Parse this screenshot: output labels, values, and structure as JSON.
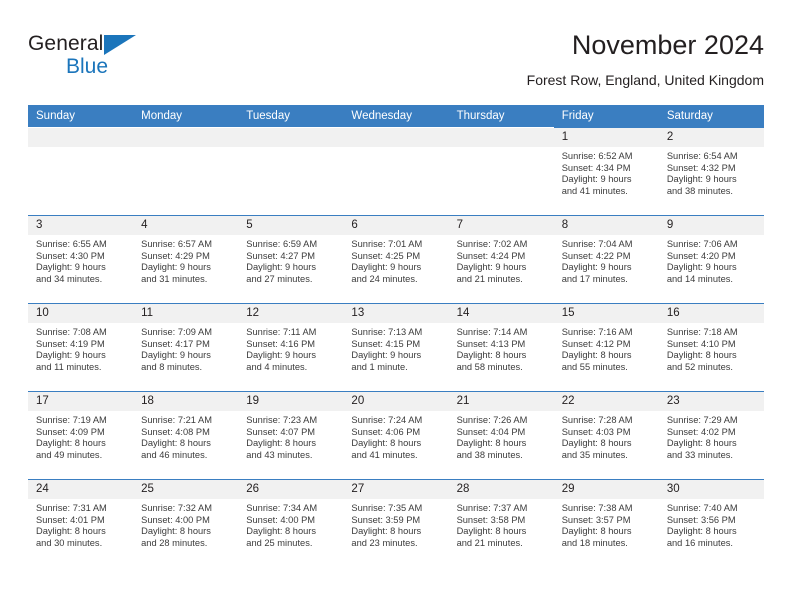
{
  "logo": {
    "word1": "General",
    "word2": "Blue",
    "triangle_color": "#1b75bb",
    "icon": "triangle-icon"
  },
  "header": {
    "month_title": "November 2024",
    "location": "Forest Row, England, United Kingdom"
  },
  "calendar": {
    "header_bg": "#3a7ec1",
    "daynum_bg": "#f1f1f1",
    "weekdays": [
      "Sunday",
      "Monday",
      "Tuesday",
      "Wednesday",
      "Thursday",
      "Friday",
      "Saturday"
    ],
    "weeks": [
      [
        {
          "empty": true
        },
        {
          "empty": true
        },
        {
          "empty": true
        },
        {
          "empty": true
        },
        {
          "empty": true
        },
        {
          "day": "1",
          "sunrise": "Sunrise: 6:52 AM",
          "sunset": "Sunset: 4:34 PM",
          "daylight1": "Daylight: 9 hours",
          "daylight2": "and 41 minutes."
        },
        {
          "day": "2",
          "sunrise": "Sunrise: 6:54 AM",
          "sunset": "Sunset: 4:32 PM",
          "daylight1": "Daylight: 9 hours",
          "daylight2": "and 38 minutes."
        }
      ],
      [
        {
          "day": "3",
          "sunrise": "Sunrise: 6:55 AM",
          "sunset": "Sunset: 4:30 PM",
          "daylight1": "Daylight: 9 hours",
          "daylight2": "and 34 minutes."
        },
        {
          "day": "4",
          "sunrise": "Sunrise: 6:57 AM",
          "sunset": "Sunset: 4:29 PM",
          "daylight1": "Daylight: 9 hours",
          "daylight2": "and 31 minutes."
        },
        {
          "day": "5",
          "sunrise": "Sunrise: 6:59 AM",
          "sunset": "Sunset: 4:27 PM",
          "daylight1": "Daylight: 9 hours",
          "daylight2": "and 27 minutes."
        },
        {
          "day": "6",
          "sunrise": "Sunrise: 7:01 AM",
          "sunset": "Sunset: 4:25 PM",
          "daylight1": "Daylight: 9 hours",
          "daylight2": "and 24 minutes."
        },
        {
          "day": "7",
          "sunrise": "Sunrise: 7:02 AM",
          "sunset": "Sunset: 4:24 PM",
          "daylight1": "Daylight: 9 hours",
          "daylight2": "and 21 minutes."
        },
        {
          "day": "8",
          "sunrise": "Sunrise: 7:04 AM",
          "sunset": "Sunset: 4:22 PM",
          "daylight1": "Daylight: 9 hours",
          "daylight2": "and 17 minutes."
        },
        {
          "day": "9",
          "sunrise": "Sunrise: 7:06 AM",
          "sunset": "Sunset: 4:20 PM",
          "daylight1": "Daylight: 9 hours",
          "daylight2": "and 14 minutes."
        }
      ],
      [
        {
          "day": "10",
          "sunrise": "Sunrise: 7:08 AM",
          "sunset": "Sunset: 4:19 PM",
          "daylight1": "Daylight: 9 hours",
          "daylight2": "and 11 minutes."
        },
        {
          "day": "11",
          "sunrise": "Sunrise: 7:09 AM",
          "sunset": "Sunset: 4:17 PM",
          "daylight1": "Daylight: 9 hours",
          "daylight2": "and 8 minutes."
        },
        {
          "day": "12",
          "sunrise": "Sunrise: 7:11 AM",
          "sunset": "Sunset: 4:16 PM",
          "daylight1": "Daylight: 9 hours",
          "daylight2": "and 4 minutes."
        },
        {
          "day": "13",
          "sunrise": "Sunrise: 7:13 AM",
          "sunset": "Sunset: 4:15 PM",
          "daylight1": "Daylight: 9 hours",
          "daylight2": "and 1 minute."
        },
        {
          "day": "14",
          "sunrise": "Sunrise: 7:14 AM",
          "sunset": "Sunset: 4:13 PM",
          "daylight1": "Daylight: 8 hours",
          "daylight2": "and 58 minutes."
        },
        {
          "day": "15",
          "sunrise": "Sunrise: 7:16 AM",
          "sunset": "Sunset: 4:12 PM",
          "daylight1": "Daylight: 8 hours",
          "daylight2": "and 55 minutes."
        },
        {
          "day": "16",
          "sunrise": "Sunrise: 7:18 AM",
          "sunset": "Sunset: 4:10 PM",
          "daylight1": "Daylight: 8 hours",
          "daylight2": "and 52 minutes."
        }
      ],
      [
        {
          "day": "17",
          "sunrise": "Sunrise: 7:19 AM",
          "sunset": "Sunset: 4:09 PM",
          "daylight1": "Daylight: 8 hours",
          "daylight2": "and 49 minutes."
        },
        {
          "day": "18",
          "sunrise": "Sunrise: 7:21 AM",
          "sunset": "Sunset: 4:08 PM",
          "daylight1": "Daylight: 8 hours",
          "daylight2": "and 46 minutes."
        },
        {
          "day": "19",
          "sunrise": "Sunrise: 7:23 AM",
          "sunset": "Sunset: 4:07 PM",
          "daylight1": "Daylight: 8 hours",
          "daylight2": "and 43 minutes."
        },
        {
          "day": "20",
          "sunrise": "Sunrise: 7:24 AM",
          "sunset": "Sunset: 4:06 PM",
          "daylight1": "Daylight: 8 hours",
          "daylight2": "and 41 minutes."
        },
        {
          "day": "21",
          "sunrise": "Sunrise: 7:26 AM",
          "sunset": "Sunset: 4:04 PM",
          "daylight1": "Daylight: 8 hours",
          "daylight2": "and 38 minutes."
        },
        {
          "day": "22",
          "sunrise": "Sunrise: 7:28 AM",
          "sunset": "Sunset: 4:03 PM",
          "daylight1": "Daylight: 8 hours",
          "daylight2": "and 35 minutes."
        },
        {
          "day": "23",
          "sunrise": "Sunrise: 7:29 AM",
          "sunset": "Sunset: 4:02 PM",
          "daylight1": "Daylight: 8 hours",
          "daylight2": "and 33 minutes."
        }
      ],
      [
        {
          "day": "24",
          "sunrise": "Sunrise: 7:31 AM",
          "sunset": "Sunset: 4:01 PM",
          "daylight1": "Daylight: 8 hours",
          "daylight2": "and 30 minutes."
        },
        {
          "day": "25",
          "sunrise": "Sunrise: 7:32 AM",
          "sunset": "Sunset: 4:00 PM",
          "daylight1": "Daylight: 8 hours",
          "daylight2": "and 28 minutes."
        },
        {
          "day": "26",
          "sunrise": "Sunrise: 7:34 AM",
          "sunset": "Sunset: 4:00 PM",
          "daylight1": "Daylight: 8 hours",
          "daylight2": "and 25 minutes."
        },
        {
          "day": "27",
          "sunrise": "Sunrise: 7:35 AM",
          "sunset": "Sunset: 3:59 PM",
          "daylight1": "Daylight: 8 hours",
          "daylight2": "and 23 minutes."
        },
        {
          "day": "28",
          "sunrise": "Sunrise: 7:37 AM",
          "sunset": "Sunset: 3:58 PM",
          "daylight1": "Daylight: 8 hours",
          "daylight2": "and 21 minutes."
        },
        {
          "day": "29",
          "sunrise": "Sunrise: 7:38 AM",
          "sunset": "Sunset: 3:57 PM",
          "daylight1": "Daylight: 8 hours",
          "daylight2": "and 18 minutes."
        },
        {
          "day": "30",
          "sunrise": "Sunrise: 7:40 AM",
          "sunset": "Sunset: 3:56 PM",
          "daylight1": "Daylight: 8 hours",
          "daylight2": "and 16 minutes."
        }
      ]
    ]
  }
}
